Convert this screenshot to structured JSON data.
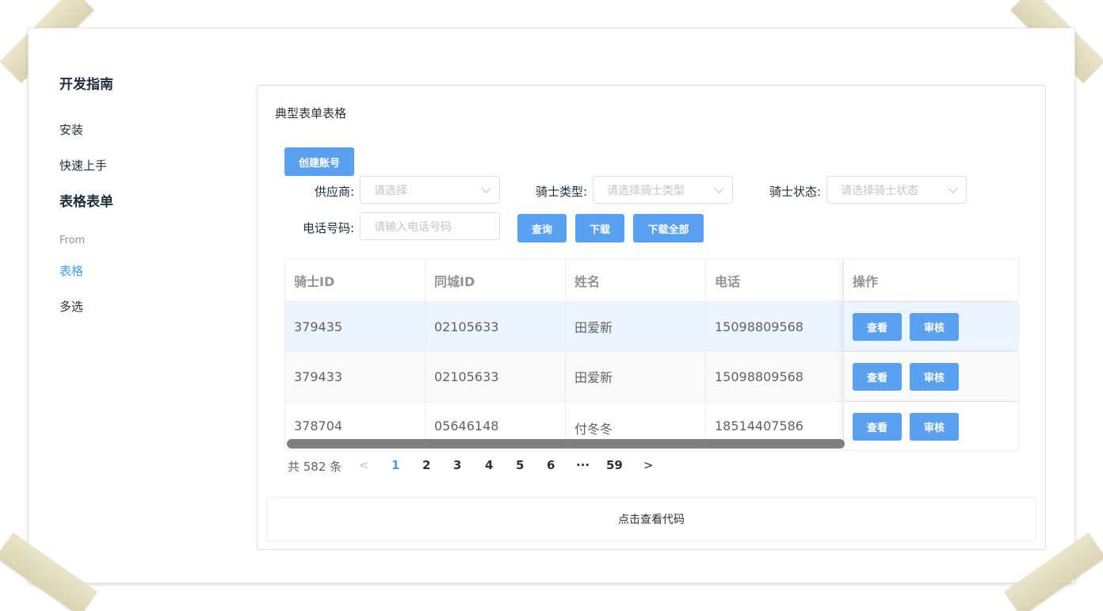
{
  "sidebar": {
    "title": "开发指南",
    "items": [
      {
        "label": "安装"
      },
      {
        "label": "快速上手"
      }
    ],
    "group_title": "表格表单",
    "sub_label": "From",
    "active_label": "表格",
    "other_label": "多选"
  },
  "card": {
    "title": "典型表单表格",
    "create_button": "创建账号"
  },
  "filters": {
    "supplier_label": "供应商:",
    "supplier_placeholder": "请选择",
    "rider_type_label": "骑士类型:",
    "rider_type_placeholder": "请选择骑士类型",
    "rider_status_label": "骑士状态:",
    "rider_status_placeholder": "请选择骑士状态",
    "phone_label": "电话号码:",
    "phone_placeholder": "请输入电话号码",
    "query_button": "查询",
    "download_button": "下载",
    "download_all_button": "下载全部"
  },
  "table": {
    "columns": [
      "骑士ID",
      "同城ID",
      "姓名",
      "电话",
      "操作"
    ],
    "rows": [
      {
        "rider_id": "379435",
        "city_id": "02105633",
        "name": "田爱新",
        "phone": "15098809568"
      },
      {
        "rider_id": "379433",
        "city_id": "02105633",
        "name": "田爱新",
        "phone": "15098809568"
      },
      {
        "rider_id": "378704",
        "city_id": "05646148",
        "name": "付冬冬",
        "phone": "18514407586"
      }
    ],
    "view_label": "查看",
    "review_label": "审核"
  },
  "pagination": {
    "total": "共 582 条",
    "prev": "<",
    "pages": [
      "1",
      "2",
      "3",
      "4",
      "5",
      "6"
    ],
    "ellipsis": "···",
    "last": "59",
    "next": ">",
    "current": "1"
  },
  "code_bar": {
    "label": "点击查看代码"
  },
  "colors": {
    "primary": "#409eff",
    "button": "#5aa0f0",
    "hover_row": "#ecf5ff"
  }
}
